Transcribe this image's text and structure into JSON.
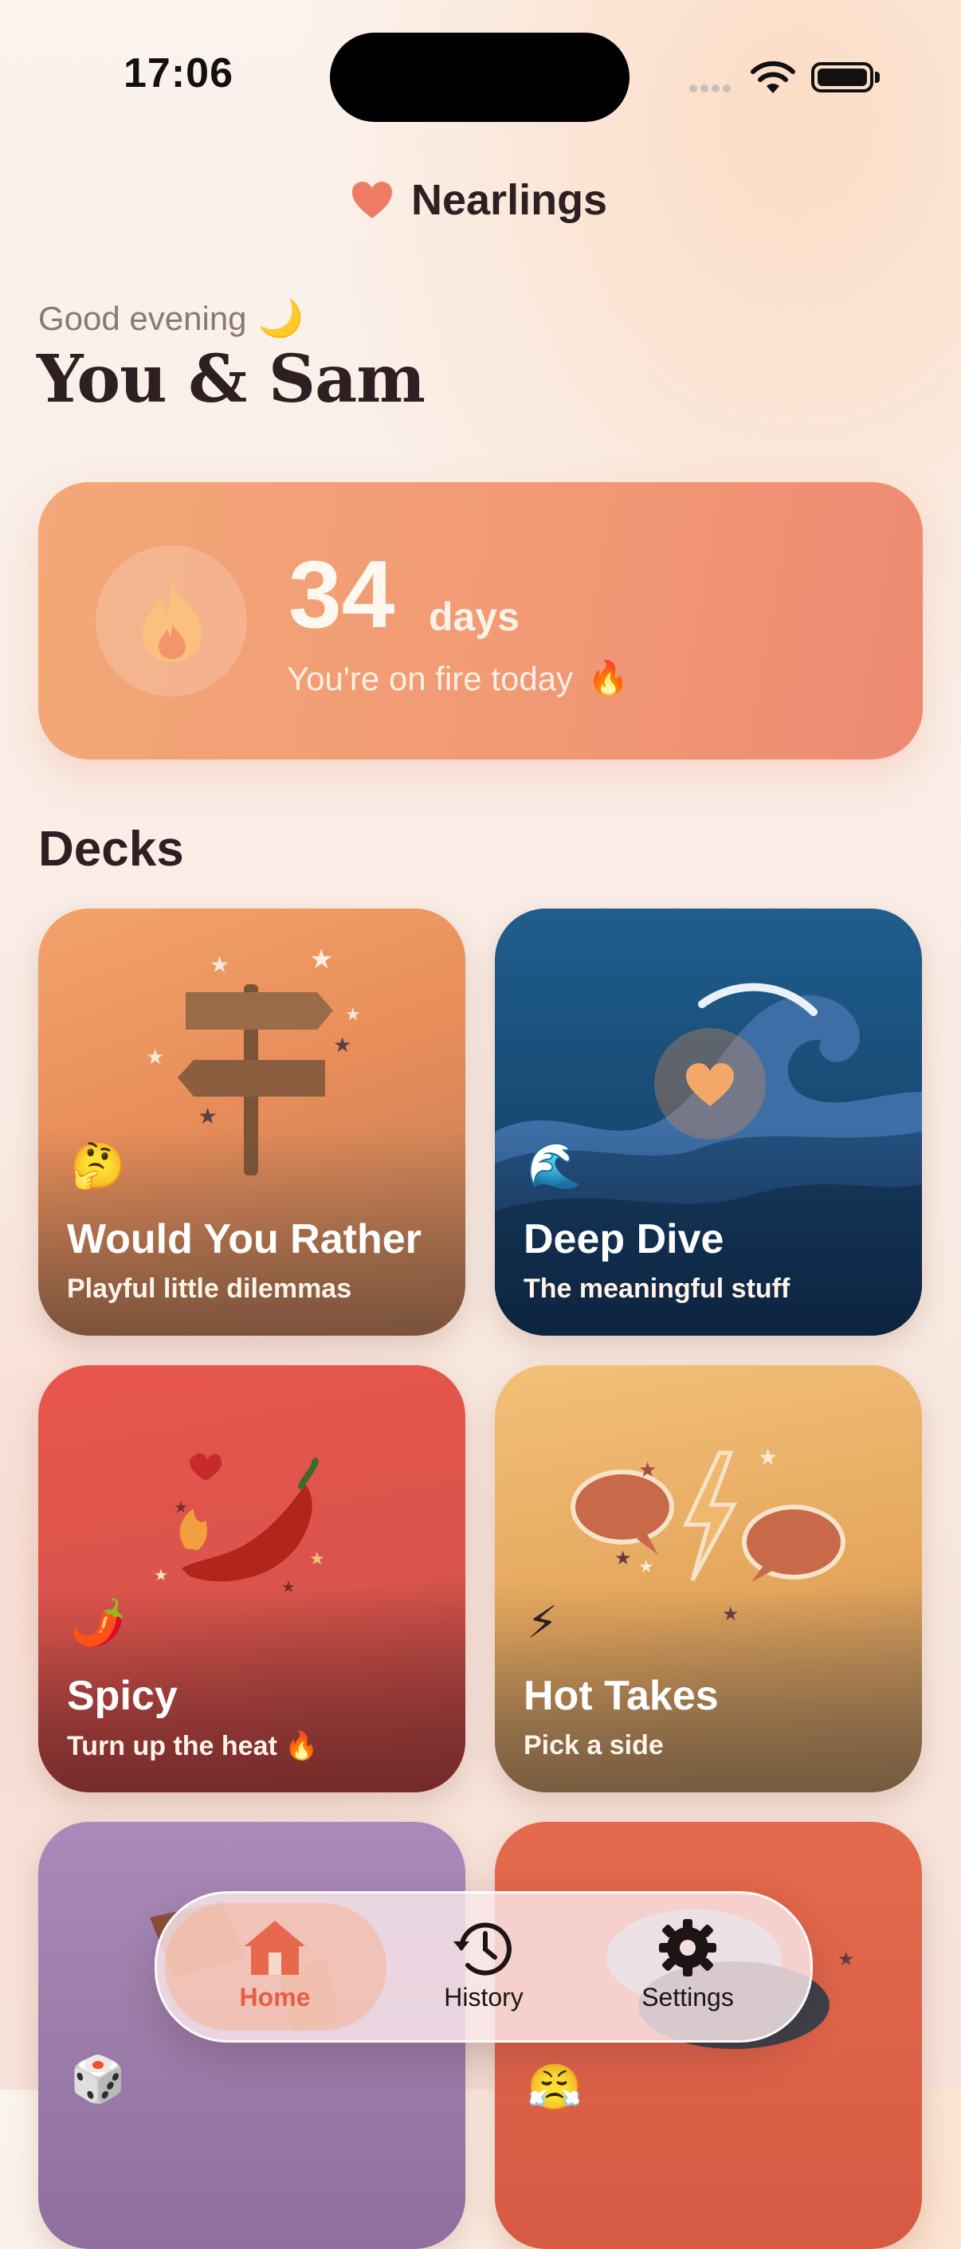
{
  "status_bar": {
    "time": "17:06"
  },
  "header": {
    "app_name": "Nearlings"
  },
  "greeting": {
    "text": "Good evening",
    "icon": "🌙",
    "title": "You & Sam"
  },
  "streak": {
    "count": "34",
    "unit": "days",
    "message": "You're on fire today",
    "emoji": "🔥"
  },
  "decks_section": {
    "title": "Decks"
  },
  "decks": [
    {
      "emoji": "🤔",
      "title": "Would You Rather",
      "subtitle": "Playful little dilemmas"
    },
    {
      "emoji": "🌊",
      "title": "Deep Dive",
      "subtitle": "The meaningful stuff"
    },
    {
      "emoji": "🌶️",
      "title": "Spicy",
      "subtitle": "Turn up the heat 🔥"
    },
    {
      "emoji": "⚡",
      "title": "Hot Takes",
      "subtitle": "Pick a side"
    },
    {
      "emoji": "🎲"
    },
    {
      "emoji": "😤"
    }
  ],
  "tabbar": {
    "active": "Home",
    "tabs": [
      {
        "label": "Home",
        "icon": "house-icon"
      },
      {
        "label": "History",
        "icon": "history-clock-icon"
      },
      {
        "label": "Settings",
        "icon": "gear-icon"
      }
    ]
  },
  "colors": {
    "accent": "#e85e45",
    "streak_card": "#f19874",
    "text_dark": "#2e1f22"
  }
}
